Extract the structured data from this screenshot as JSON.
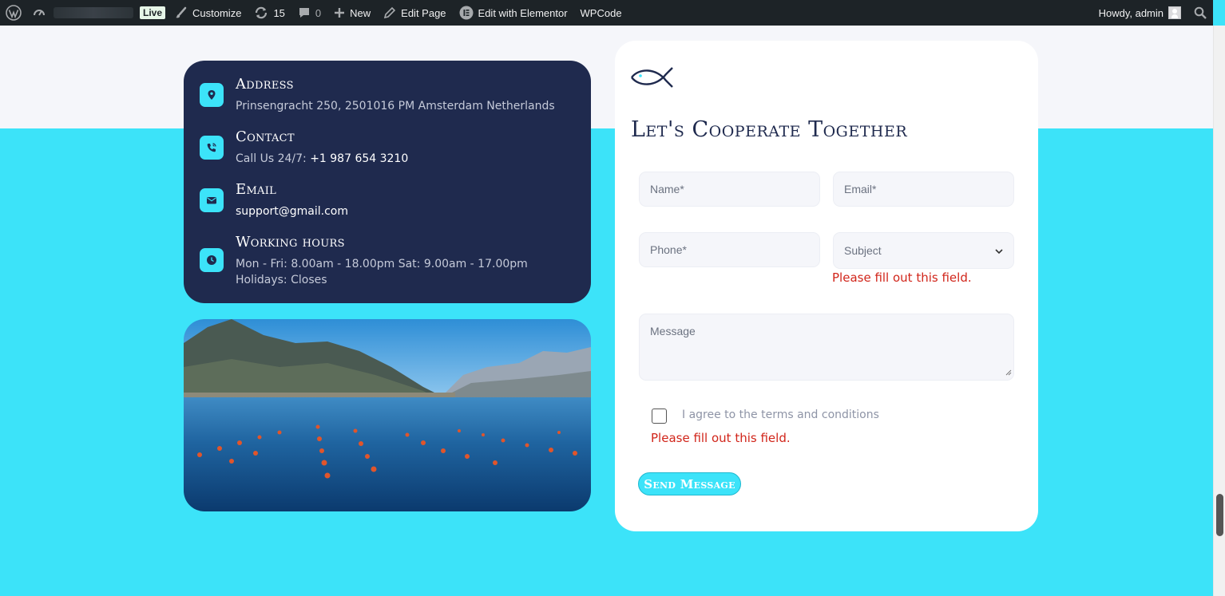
{
  "admin_bar": {
    "live_label": "Live",
    "customize_label": "Customize",
    "updates_count": "15",
    "comments_count": "0",
    "new_label": "New",
    "edit_page_label": "Edit Page",
    "elementor_label": "Edit with Elementor",
    "wpcode_label": "WPCode",
    "howdy_label": "Howdy, admin"
  },
  "info": {
    "address_title": "Address",
    "address_text": "Prinsengracht 250, 2501016 PM Amsterdam Netherlands",
    "contact_title": "Contact",
    "contact_prefix": "Call Us 24/7: ",
    "contact_phone": "+1 987 654 3210",
    "email_title": "Email",
    "email_text": "support@gmail.com",
    "hours_title": "Working hours",
    "hours_text": "Mon - Fri: 8.00am - 18.00pm Sat: 9.00am - 17.00pm Holidays: Closes"
  },
  "form": {
    "title": "Let's Cooperate Together",
    "name_placeholder": "Name*",
    "email_placeholder": "Email*",
    "phone_placeholder": "Phone*",
    "subject_selected": "Subject",
    "message_placeholder": "Message",
    "subject_error": "Please fill out this field.",
    "agree_label": "I agree to the terms and conditions",
    "agree_error": "Please fill out this field.",
    "send_label": "Send Message"
  },
  "colors": {
    "accent": "#3ce3f9",
    "navy": "#1f2a4e",
    "error": "#d1251a",
    "admin_bar": "#1d2327"
  },
  "icons": {
    "address": "map-pin-icon",
    "contact": "phone-ring-icon",
    "email": "envelope-icon",
    "hours": "clock-icon",
    "logo": "fish-logo-icon"
  }
}
